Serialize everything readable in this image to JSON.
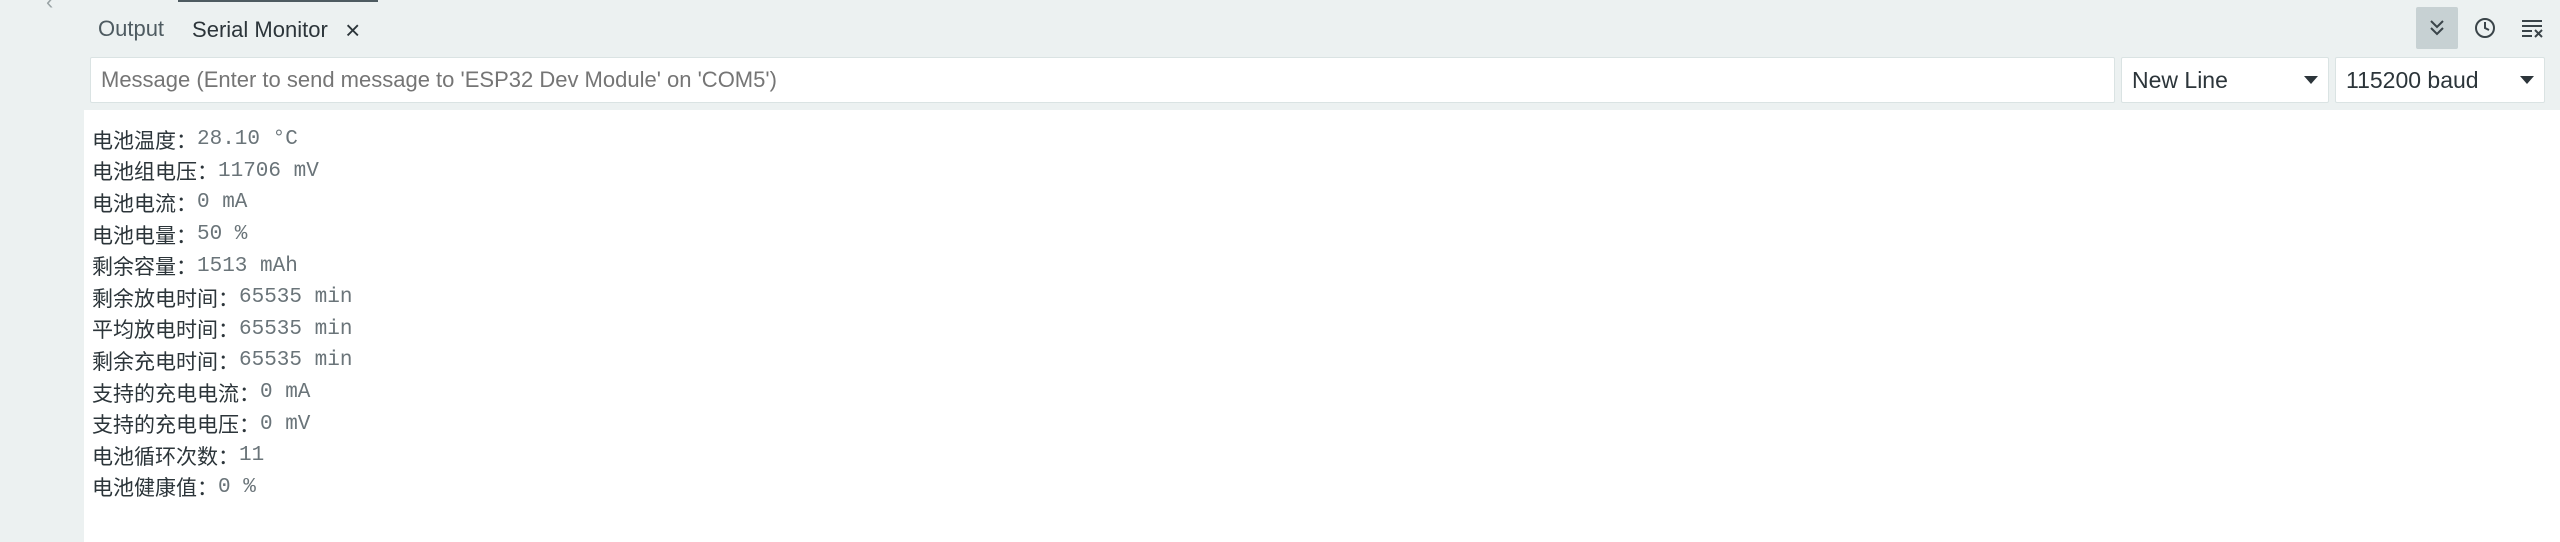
{
  "tabs": [
    {
      "label": "Output",
      "active": false
    },
    {
      "label": "Serial Monitor",
      "active": true
    }
  ],
  "toolbar": {
    "icons": [
      "autoscroll-icon",
      "timestamp-icon",
      "clear-output-icon"
    ],
    "autoscroll_pressed": true
  },
  "message_input": {
    "placeholder": "Message (Enter to send message to 'ESP32 Dev Module' on 'COM5')",
    "value": ""
  },
  "line_ending_select": {
    "selected": "New Line"
  },
  "baud_select": {
    "selected": "115200 baud"
  },
  "output": {
    "lines": [
      {
        "key": "电池温度：",
        "value": "28.10 °C"
      },
      {
        "key": "电池组电压：",
        "value": "11706 mV"
      },
      {
        "key": "电池电流：",
        "value": "0 mA"
      },
      {
        "key": "电池电量：",
        "value": "50 %"
      },
      {
        "key": "剩余容量：",
        "value": "1513 mAh"
      },
      {
        "key": "剩余放电时间：",
        "value": "65535 min"
      },
      {
        "key": "平均放电时间：",
        "value": "65535 min"
      },
      {
        "key": "剩余充电时间：",
        "value": "65535 min"
      },
      {
        "key": "支持的充电电流：",
        "value": "0 mA"
      },
      {
        "key": "支持的充电电压：",
        "value": "0 mV"
      },
      {
        "key": "电池循环次数：",
        "value": "11"
      },
      {
        "key": "电池健康值：",
        "value": "0 %"
      }
    ]
  },
  "colors": {
    "panel_bg": "#ecf1f1",
    "output_bg": "#ffffff",
    "text": "#2c353a",
    "value_text": "#6a7479"
  }
}
